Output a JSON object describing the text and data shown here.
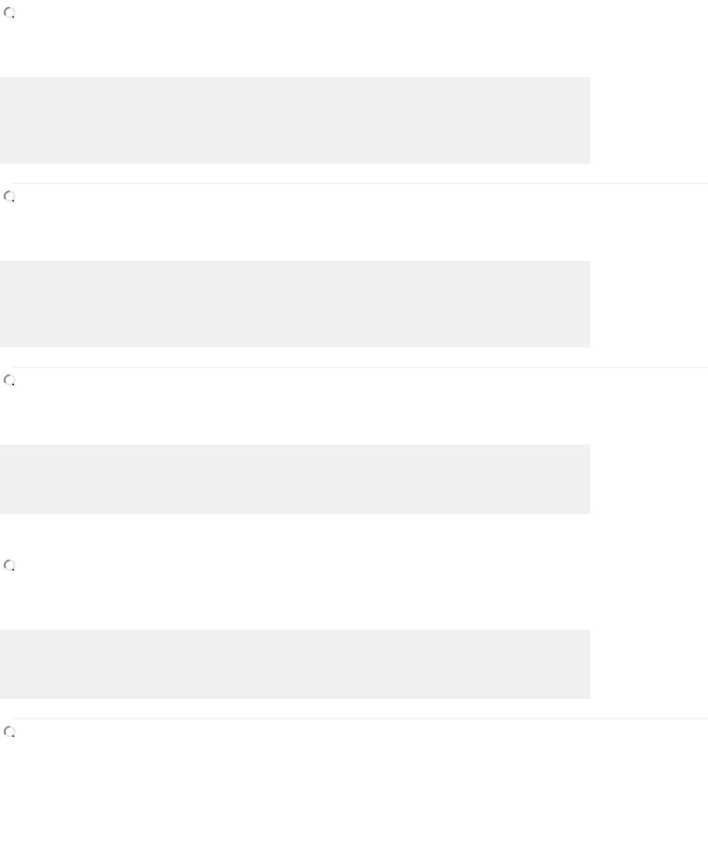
{
  "sections": [
    {
      "kind": "tall",
      "loading": true,
      "divider": true
    },
    {
      "kind": "tall",
      "loading": true,
      "divider": true
    },
    {
      "kind": "short",
      "loading": true,
      "divider": false
    },
    {
      "kind": "short",
      "loading": true,
      "divider": true
    },
    {
      "kind": "empty",
      "loading": true,
      "divider": false
    }
  ]
}
